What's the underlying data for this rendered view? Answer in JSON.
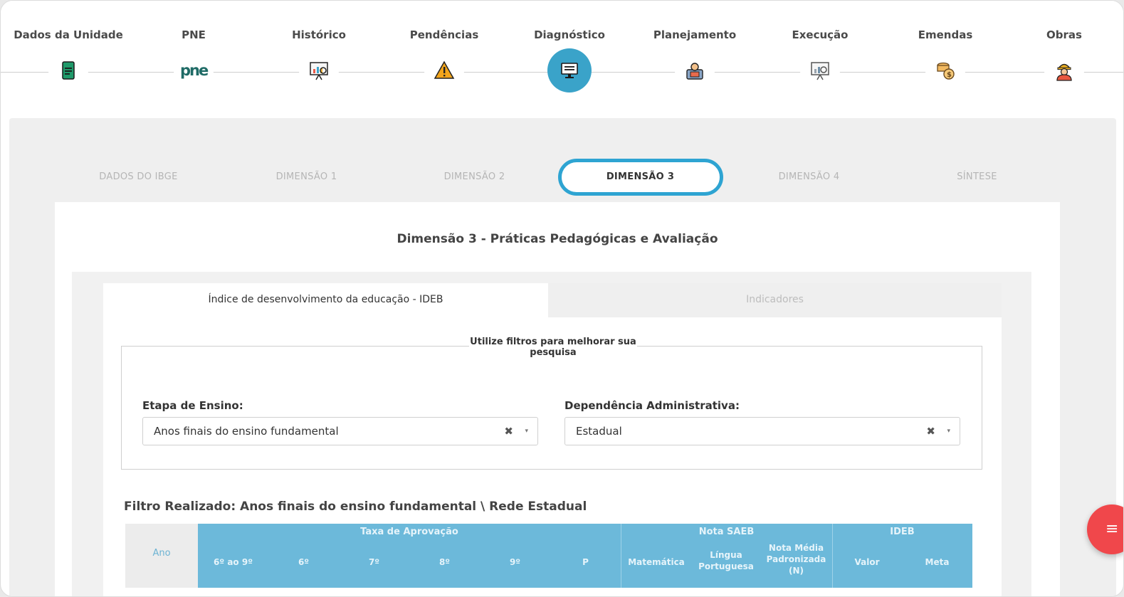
{
  "steps": [
    {
      "label": "Dados da Unidade",
      "icon": "document-icon"
    },
    {
      "label": "PNE",
      "icon": "pne-logo-icon"
    },
    {
      "label": "Histórico",
      "icon": "presentation-chart-icon"
    },
    {
      "label": "Pendências",
      "icon": "warning-icon"
    },
    {
      "label": "Diagnóstico",
      "icon": "monitor-icon"
    },
    {
      "label": "Planejamento",
      "icon": "planning-person-icon"
    },
    {
      "label": "Execução",
      "icon": "presentation-analysis-icon"
    },
    {
      "label": "Emendas",
      "icon": "coins-icon"
    },
    {
      "label": "Obras",
      "icon": "construction-worker-icon"
    }
  ],
  "tabs": [
    "DADOS DO IBGE",
    "DIMENSÃO 1",
    "DIMENSÃO 2",
    "DIMENSÃO 3",
    "DIMENSÃO 4",
    "SÍNTESE"
  ],
  "active_tab": "DIMENSÃO 3",
  "card": {
    "title": "Dimensão 3 - Práticas Pedagógicas e Avaliação"
  },
  "subtabs": {
    "ideb": "Índice de desenvolvimento da educação - IDEB",
    "indicadores": "Indicadores"
  },
  "filters": {
    "legend": "Utilize filtros para melhorar sua pesquisa",
    "etapa_label": "Etapa de Ensino:",
    "etapa_value": "Anos finais do ensino fundamental",
    "dependencia_label": "Dependência Administrativa:",
    "dependencia_value": "Estadual",
    "clear": "✖",
    "caret": "▾"
  },
  "filtro_realizado": "Filtro Realizado: Anos finais do ensino fundamental \\ Rede Estadual",
  "table": {
    "ano": "Ano",
    "groups": {
      "aprovacao": "Taxa de Aprovação",
      "saeb": "Nota SAEB",
      "ideb": "IDEB"
    },
    "columns": [
      "6º ao 9º",
      "6º",
      "7º",
      "8º",
      "9º",
      "P",
      "Matemática",
      "Língua Portuguesa",
      "Nota Média Padronizada (N)",
      "Valor",
      "Meta"
    ]
  },
  "fab": {
    "icon": "menu-icon",
    "glyph": "≡"
  },
  "colors": {
    "accent": "#3aa3c9",
    "table_header": "#6cb9da",
    "fab": "#f0474b"
  }
}
